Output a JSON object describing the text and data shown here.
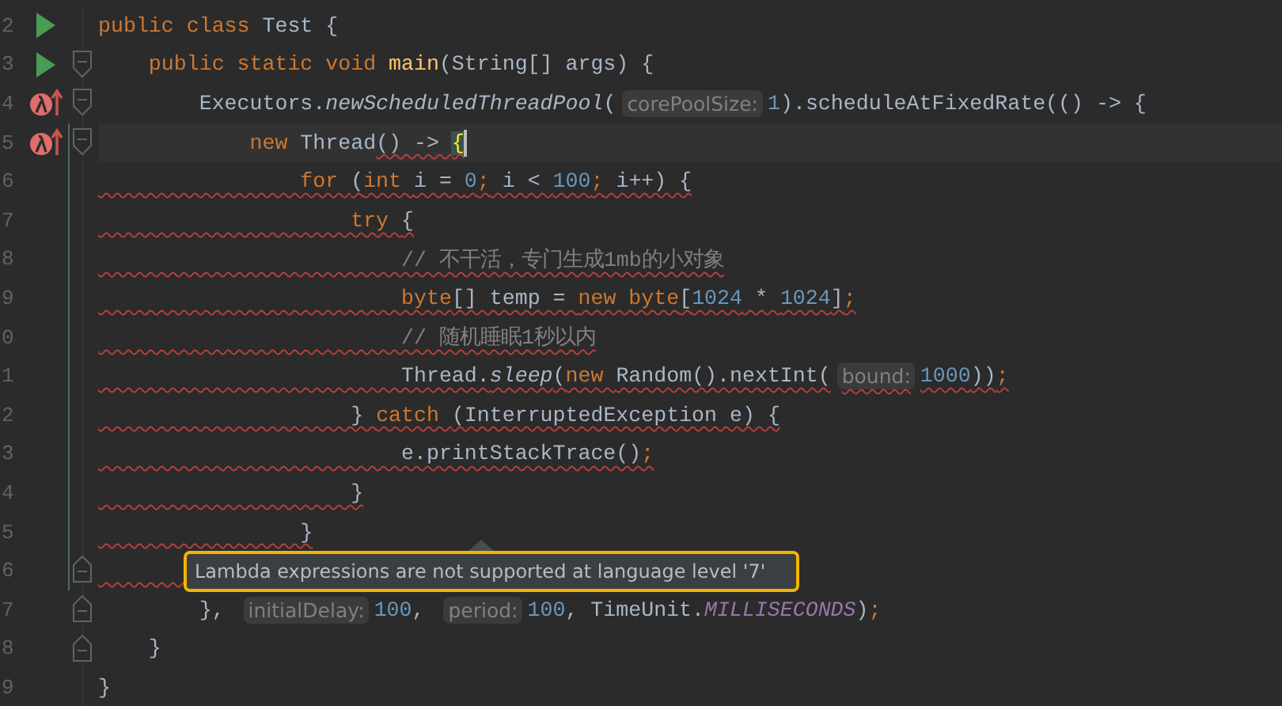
{
  "editor": {
    "lines": [
      {
        "number": "2",
        "runnable": true,
        "tokens": [
          {
            "t": "public class ",
            "kind": "kw"
          },
          {
            "t": "Test {",
            "kind": "p"
          }
        ]
      },
      {
        "number": "3",
        "runnable": true,
        "fold_start": true,
        "tokens": [
          {
            "t": "    public static void ",
            "kind": "kw"
          },
          {
            "t": "main",
            "kind": "decl"
          },
          {
            "t": "(String[] args) {",
            "kind": "p"
          }
        ]
      },
      {
        "number": "4",
        "lambda_marker": true,
        "fold_start": true,
        "tokens": [
          {
            "t": "        Executors.",
            "kind": "p"
          },
          {
            "t": "newScheduledThreadPool",
            "kind": "it"
          },
          {
            "t": "(",
            "kind": "p"
          },
          {
            "t": "corePoolSize:",
            "kind": "hint"
          },
          {
            "t": "1",
            "kind": "num"
          },
          {
            "t": ").scheduleAtFixedRate(() -> {",
            "kind": "p"
          }
        ]
      },
      {
        "number": "5",
        "lambda_marker": true,
        "fold_start": true,
        "current": true,
        "changed": true,
        "tokens": [
          {
            "t": "            new ",
            "kind": "kw"
          },
          {
            "t": "Thread",
            "kind": "p"
          },
          {
            "t": "() -> ",
            "kind": "p",
            "error": true
          },
          {
            "t": "{",
            "kind": "brace",
            "error": true
          }
        ]
      },
      {
        "number": "6",
        "error": true,
        "changed": true,
        "tokens": [
          {
            "t": "                for ",
            "kind": "kw"
          },
          {
            "t": "(",
            "kind": "p"
          },
          {
            "t": "int ",
            "kind": "kw"
          },
          {
            "t": "i = ",
            "kind": "p"
          },
          {
            "t": "0",
            "kind": "num"
          },
          {
            "t": ";",
            "kind": "kw"
          },
          {
            "t": " i < ",
            "kind": "p"
          },
          {
            "t": "100",
            "kind": "num"
          },
          {
            "t": ";",
            "kind": "kw"
          },
          {
            "t": " i++) {",
            "kind": "p"
          }
        ]
      },
      {
        "number": "7",
        "error": true,
        "changed": true,
        "tokens": [
          {
            "t": "                    try ",
            "kind": "kw"
          },
          {
            "t": "{",
            "kind": "p"
          }
        ]
      },
      {
        "number": "8",
        "error": true,
        "changed": true,
        "tokens": [
          {
            "t": "                        // 不干活，专门生成1mb的小对象",
            "kind": "c"
          }
        ]
      },
      {
        "number": "9",
        "error": true,
        "changed": true,
        "tokens": [
          {
            "t": "                        byte",
            "kind": "kw"
          },
          {
            "t": "[] temp = ",
            "kind": "p"
          },
          {
            "t": "new byte",
            "kind": "kw"
          },
          {
            "t": "[",
            "kind": "p"
          },
          {
            "t": "1024",
            "kind": "num"
          },
          {
            "t": " * ",
            "kind": "p"
          },
          {
            "t": "1024",
            "kind": "num"
          },
          {
            "t": "]",
            "kind": "p"
          },
          {
            "t": ";",
            "kind": "kw"
          }
        ]
      },
      {
        "number": "0",
        "error": true,
        "changed": true,
        "tokens": [
          {
            "t": "                        // 随机睡眠1秒以内",
            "kind": "c"
          }
        ]
      },
      {
        "number": "1",
        "error": true,
        "changed": true,
        "tokens": [
          {
            "t": "                        Thread.",
            "kind": "p"
          },
          {
            "t": "sleep",
            "kind": "it"
          },
          {
            "t": "(",
            "kind": "p"
          },
          {
            "t": "new ",
            "kind": "kw"
          },
          {
            "t": "Random().nextInt(",
            "kind": "p"
          },
          {
            "t": "bound:",
            "kind": "hint"
          },
          {
            "t": "1000",
            "kind": "num"
          },
          {
            "t": "))",
            "kind": "p"
          },
          {
            "t": ";",
            "kind": "kw"
          }
        ]
      },
      {
        "number": "2",
        "error": true,
        "changed": true,
        "tokens": [
          {
            "t": "                    } ",
            "kind": "p"
          },
          {
            "t": "catch ",
            "kind": "kw"
          },
          {
            "t": "(InterruptedException e) {",
            "kind": "p"
          }
        ]
      },
      {
        "number": "3",
        "error": true,
        "changed": true,
        "tokens": [
          {
            "t": "                        e.printStackTrace()",
            "kind": "p"
          },
          {
            "t": ";",
            "kind": "kw"
          }
        ]
      },
      {
        "number": "4",
        "error": true,
        "changed": true,
        "tokens": [
          {
            "t": "                    }",
            "kind": "p"
          }
        ]
      },
      {
        "number": "5",
        "error": true,
        "changed": true,
        "tokens": [
          {
            "t": "                }",
            "kind": "p"
          }
        ]
      },
      {
        "number": "6",
        "fold_end": true,
        "error": true,
        "changed": true
      },
      {
        "number": "7",
        "fold_end": true,
        "tokens": [
          {
            "t": "        }, ",
            "kind": "p"
          },
          {
            "t": "initialDelay:",
            "kind": "hint"
          },
          {
            "t": "100",
            "kind": "num"
          },
          {
            "t": ", ",
            "kind": "p"
          },
          {
            "t": "period:",
            "kind": "hint"
          },
          {
            "t": "100",
            "kind": "num"
          },
          {
            "t": ", TimeUnit.",
            "kind": "p"
          },
          {
            "t": "MILLISECONDS",
            "kind": "const"
          },
          {
            "t": ")",
            "kind": "p"
          },
          {
            "t": ";",
            "kind": "kw"
          }
        ]
      },
      {
        "number": "8",
        "fold_end": true,
        "tokens": [
          {
            "t": "    }",
            "kind": "p"
          }
        ]
      },
      {
        "number": "9",
        "tokens": [
          {
            "t": "}",
            "kind": "p"
          }
        ]
      }
    ]
  },
  "tooltip": {
    "text": "Lambda expressions are not supported at language level '7'"
  }
}
